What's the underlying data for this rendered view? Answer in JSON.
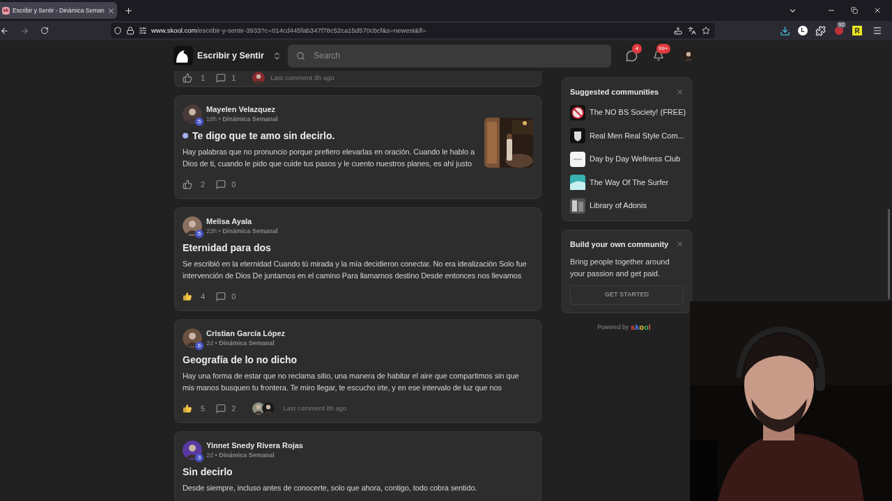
{
  "browser": {
    "tab": {
      "title": "Escribir y Sentir - Dinámica Seman",
      "favicon": "sk",
      "selected": true
    },
    "url_host": "www.skool.com",
    "url_path": "/escribir-y-sentir-3933?c=014cd445fab347f78c52ca15d570cbcf&s=newest&fl=",
    "extensions": [
      {
        "kind": "download"
      },
      {
        "kind": "letter",
        "label": "L"
      },
      {
        "kind": "puzzle"
      },
      {
        "kind": "counter",
        "label": "92"
      },
      {
        "kind": "tile",
        "label": "R"
      }
    ]
  },
  "header": {
    "group_name": "Escribir y Sentir",
    "search": {
      "placeholder": "Search"
    },
    "chat_badge": "4",
    "notifications_badge": "99+"
  },
  "partial_post": {
    "likes": "1",
    "comments": "1",
    "last_comment": "Last comment 3h ago"
  },
  "posts": [
    {
      "author": "Mayelen Velazquez",
      "level": "5",
      "meta": "18h • **Dinámica Semanal**",
      "unread": true,
      "title": "Te digo que te amo sin decirlo.",
      "body_lines": [
        "Hay palabras que no pronuncio porque prefiero elevarlas en oración. Cuando le hablo a",
        "Dios de ti, cuando le pido que cuide tus pasos y le cuento nuestros planes, es ahí justo"
      ],
      "liked": false,
      "likes": "2",
      "comments": "0"
    },
    {
      "author": "Melisa Ayala",
      "level": "5",
      "meta": "23h • **Dinámica Semanal**",
      "unread": false,
      "title": "Eternidad para dos",
      "body_lines": [
        "Se escribió en la eternidad Cuando tú mirada y la mía decidieron conectar. No era idealización Solo fue",
        "intervención de Dios De juntarnos en el camino Para llamarnos destino Desde entonces nos llevamos"
      ],
      "liked": true,
      "likes": "4",
      "comments": "0"
    },
    {
      "author": "Cristian García López",
      "level": "6",
      "meta": "2d • **Dinámica Semanal**",
      "unread": false,
      "title": "Geografía de lo no dicho",
      "body_lines": [
        "Hay una forma de estar que no reclama sitio, una manera de habitar el aire que compartimos sin que",
        "mis manos busquen tu frontera. Te miro llegar, te escucho irte, y en ese intervalo de luz que nos"
      ],
      "liked": true,
      "likes": "5",
      "comments": "2",
      "last_comment": "Last comment 8h ago"
    },
    {
      "author": "Yinnet Snedy Rivera Rojas",
      "level": "3",
      "meta": "2d • **Dinámica Semanal**",
      "unread": false,
      "title": "Sin decirlo",
      "body_lines": [
        "Desde siempre, incluso antes de conocerte, solo que ahora, contigo, todo cobra sentido."
      ]
    }
  ],
  "sidebar": {
    "suggested": {
      "title": "Suggested communities",
      "items": [
        {
          "name": "The NO BS Society! (FREE)"
        },
        {
          "name": "Real Men Real Style Com..."
        },
        {
          "name": "Day by Day Wellness Club"
        },
        {
          "name": "The Way Of The Surfer"
        },
        {
          "name": "Library of Adonis"
        }
      ]
    },
    "build": {
      "title": "Build your own community",
      "text": "Bring people together around your passion and get paid.",
      "button": "GET STARTED"
    },
    "powered_by": "Powered by",
    "logo": "skool"
  }
}
